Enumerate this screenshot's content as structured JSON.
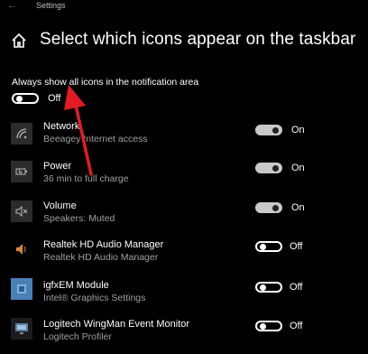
{
  "window": {
    "title": "Settings"
  },
  "page": {
    "title": "Select which icons appear on the taskbar"
  },
  "always_show": {
    "label": "Always show all icons in the notification area",
    "state": "Off"
  },
  "items": [
    {
      "name": "Network",
      "subtitle": "Beeagey  Internet access",
      "state": "On",
      "icon": "network-icon"
    },
    {
      "name": "Power",
      "subtitle": "36 min to full charge",
      "state": "On",
      "icon": "battery-icon"
    },
    {
      "name": "Volume",
      "subtitle": "Speakers: Muted",
      "state": "On",
      "icon": "speaker-muted-icon"
    },
    {
      "name": "Realtek HD Audio Manager",
      "subtitle": "Realtek HD Audio Manager",
      "state": "Off",
      "icon": "realtek-speaker-icon"
    },
    {
      "name": "igfxEM Module",
      "subtitle": "Intel® Graphics Settings",
      "state": "Off",
      "icon": "intel-graphics-icon"
    },
    {
      "name": "Logitech WingMan Event Monitor",
      "subtitle": "Logitech Profiler",
      "state": "Off",
      "icon": "logitech-monitor-icon"
    }
  ],
  "annotation": {
    "arrow_color": "#e31b23"
  }
}
